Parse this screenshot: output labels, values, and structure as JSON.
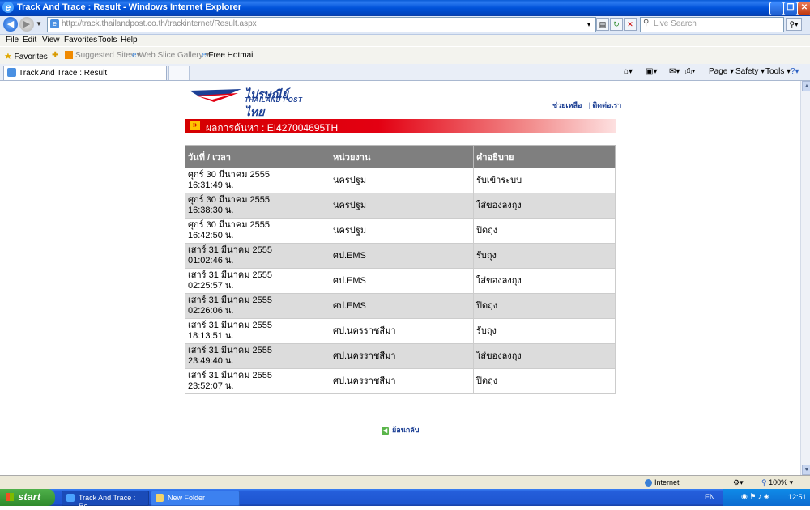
{
  "window": {
    "title": "Track And Trace : Result - Windows Internet Explorer"
  },
  "address": {
    "url": "http://track.thailandpost.co.th/trackinternet/Result.aspx",
    "search_placeholder": "Live Search"
  },
  "menu": [
    "File",
    "Edit",
    "View",
    "Favorites",
    "Tools",
    "Help"
  ],
  "favorites": {
    "label": "Favorites",
    "items": [
      "Suggested Sites ▾",
      "Web Slice Gallery ▾",
      "Free Hotmail"
    ]
  },
  "tab": {
    "title": "Track And Trace : Result"
  },
  "commands": [
    "Page ▾",
    "Safety ▾",
    "Tools ▾"
  ],
  "page": {
    "logo_th": "ไปรษณีย์ไทย",
    "logo_en": "THAILAND POST",
    "link_help": "ช่วยเหลือ",
    "link_contact": "ติดต่อเรา",
    "result_label": "ผลการค้นหา : EI427004695TH",
    "columns": [
      "วันที่ / เวลา",
      "หน่วยงาน",
      "คำอธิบาย"
    ],
    "rows": [
      {
        "date": "ศุกร์ 30 มีนาคม 2555",
        "time": "16:31:49 น.",
        "office": "นครปฐม",
        "desc": "รับเข้าระบบ"
      },
      {
        "date": "ศุกร์ 30 มีนาคม 2555",
        "time": "16:38:30 น.",
        "office": "นครปฐม",
        "desc": "ใส่ของลงถุง"
      },
      {
        "date": "ศุกร์ 30 มีนาคม 2555",
        "time": "16:42:50 น.",
        "office": "นครปฐม",
        "desc": "ปิดถุง"
      },
      {
        "date": "เสาร์ 31 มีนาคม 2555",
        "time": "01:02:46 น.",
        "office": "ศป.EMS",
        "desc": "รับถุง"
      },
      {
        "date": "เสาร์ 31 มีนาคม 2555",
        "time": "02:25:57 น.",
        "office": "ศป.EMS",
        "desc": "ใส่ของลงถุง"
      },
      {
        "date": "เสาร์ 31 มีนาคม 2555",
        "time": "02:26:06 น.",
        "office": "ศป.EMS",
        "desc": "ปิดถุง"
      },
      {
        "date": "เสาร์ 31 มีนาคม 2555",
        "time": "18:13:51 น.",
        "office": "ศป.นครราชสีมา",
        "desc": "รับถุง"
      },
      {
        "date": "เสาร์ 31 มีนาคม 2555",
        "time": "23:49:40 น.",
        "office": "ศป.นครราชสีมา",
        "desc": "ใส่ของลงถุง"
      },
      {
        "date": "เสาร์ 31 มีนาคม 2555",
        "time": "23:52:07 น.",
        "office": "ศป.นครราชสีมา",
        "desc": "ปิดถุง"
      }
    ],
    "back_label": "ย้อนกลับ"
  },
  "status": {
    "zone": "Internet",
    "zoom": "100%"
  },
  "taskbar": {
    "start": "start",
    "items": [
      "Track And Trace : Re...",
      "New Folder"
    ],
    "lang": "EN",
    "clock": "12:51"
  },
  "colors": {
    "red_bar": "#e30012",
    "header_gray": "#7f7f7f",
    "row_alt": "#dcdcdc",
    "xp_blue": "#245edb"
  }
}
